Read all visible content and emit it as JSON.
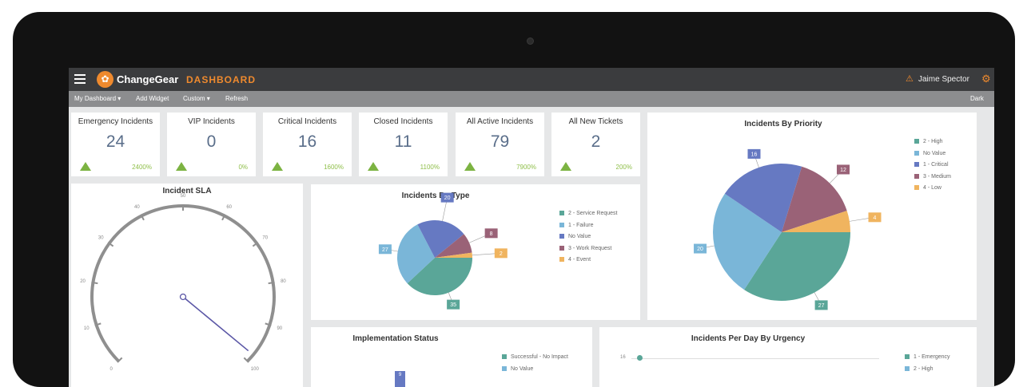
{
  "header": {
    "app_name": "ChangeGear",
    "section": "DASHBOARD",
    "user": "Jaime Spector"
  },
  "toolbar": {
    "my_dashboard": "My Dashboard ▾",
    "add_widget": "Add Widget",
    "custom": "Custom ▾",
    "refresh": "Refresh",
    "dark": "Dark"
  },
  "kpis": [
    {
      "title": "Emergency Incidents",
      "value": "24",
      "pct": "2400%"
    },
    {
      "title": "VIP Incidents",
      "value": "0",
      "pct": "0%"
    },
    {
      "title": "Critical Incidents",
      "value": "16",
      "pct": "1600%"
    },
    {
      "title": "Closed Incidents",
      "value": "11",
      "pct": "1100%"
    },
    {
      "title": "All Active Incidents",
      "value": "79",
      "pct": "7900%"
    },
    {
      "title": "All New Tickets",
      "value": "2",
      "pct": "200%"
    }
  ],
  "sla": {
    "title": "Incident SLA",
    "ticks": [
      "0",
      "10",
      "20",
      "30",
      "40",
      "50",
      "60",
      "70",
      "80",
      "90",
      "100"
    ],
    "needle_value": 98
  },
  "colors": {
    "teal": "#5aa698",
    "lightblue": "#7ab6d8",
    "indigo": "#6679c2",
    "mauve": "#9a6277",
    "orange": "#f0b45f",
    "accent": "#ef8a2e"
  },
  "by_type": {
    "title": "Incidents By Type",
    "legend": [
      "2 - Service Request",
      "1 - Failure",
      "No Value",
      "3 - Work Request",
      "4 - Event"
    ],
    "chart_data": {
      "type": "pie",
      "labels": [
        "2 - Service Request",
        "1 - Failure",
        "No Value",
        "3 - Work Request",
        "4 - Event"
      ],
      "values": [
        35,
        27,
        20,
        8,
        2
      ]
    }
  },
  "by_priority": {
    "title": "Incidents By Priority",
    "legend": [
      "2 - High",
      "No Value",
      "1 - Critical",
      "3 - Medium",
      "4 - Low"
    ],
    "chart_data": {
      "type": "pie",
      "labels": [
        "2 - High",
        "No Value",
        "1 - Critical",
        "3 - Medium",
        "4 - Low"
      ],
      "values": [
        27,
        20,
        16,
        12,
        4
      ]
    }
  },
  "impl": {
    "title": "Implementation Status",
    "legend": [
      "Successful - No Impact",
      "No Value"
    ],
    "bar_label": "9"
  },
  "urgency": {
    "title": "Incidents Per Day By Urgency",
    "y_label": "16",
    "legend": [
      "1 - Emergency",
      "2 - High"
    ]
  }
}
